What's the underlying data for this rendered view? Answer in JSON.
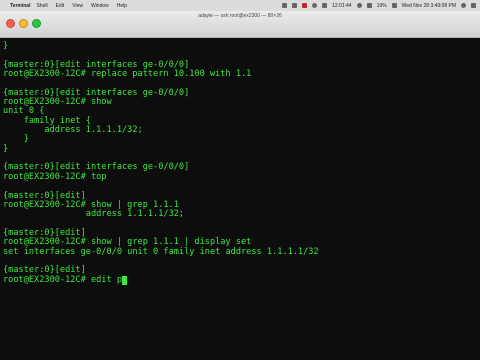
{
  "menubar": {
    "app_name": "Terminal",
    "items": [
      "Shell",
      "Edit",
      "View",
      "Window",
      "Help"
    ],
    "status": [
      "12:01:44",
      "19%"
    ],
    "clock": "Wed Nov 28  3:49:08 PM"
  },
  "window": {
    "title": "adayle — ssh root@ex2300 — 80×26"
  },
  "colors": {
    "terminal_bg": "#0d0d0d",
    "terminal_fg": "#3fe83f",
    "close": "#ff5f57",
    "minimize": "#febc2e",
    "zoom": "#28c840"
  },
  "terminal": {
    "lines": [
      "}",
      "",
      "{master:0}[edit interfaces ge-0/0/0]",
      "root@EX2300-12C# replace pattern 10.100 with 1.1",
      "",
      "{master:0}[edit interfaces ge-0/0/0]",
      "root@EX2300-12C# show",
      "unit 0 {",
      "    family inet {",
      "        address 1.1.1.1/32;",
      "    }",
      "}",
      "",
      "{master:0}[edit interfaces ge-0/0/0]",
      "root@EX2300-12C# top",
      "",
      "{master:0}[edit]",
      "root@EX2300-12C# show | grep 1.1.1",
      "                address 1.1.1.1/32;",
      "",
      "{master:0}[edit]",
      "root@EX2300-12C# show | grep 1.1.1 | display set",
      "set interfaces ge-0/0/0 unit 0 family inet address 1.1.1.1/32",
      "",
      "{master:0}[edit]",
      "root@EX2300-12C# edit p"
    ]
  }
}
